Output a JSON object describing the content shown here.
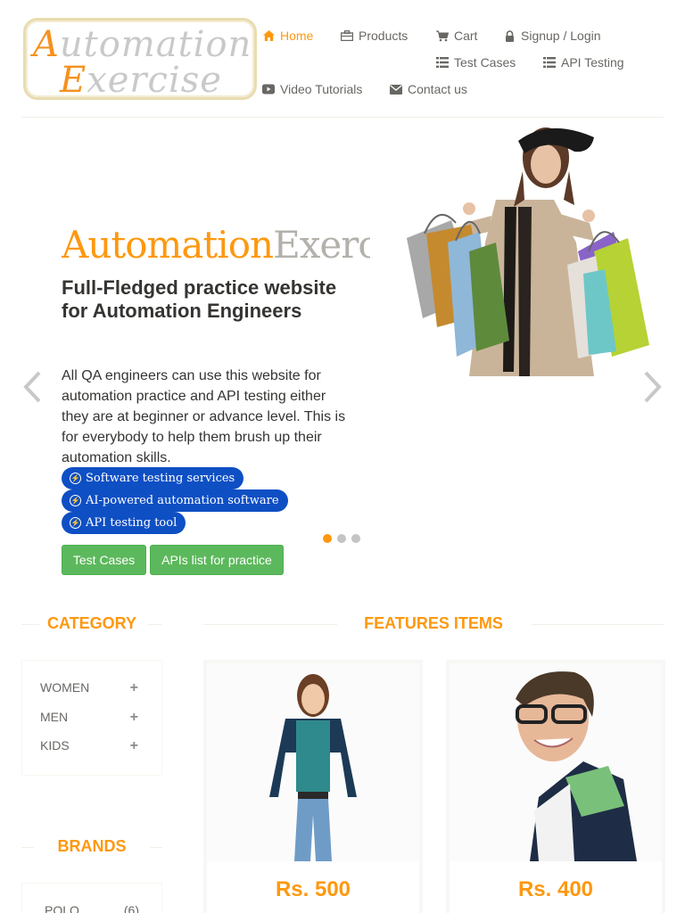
{
  "logo": {
    "line1_cap": "A",
    "line1_rest": "utomation",
    "line2_cap": "E",
    "line2_rest": "xercise"
  },
  "nav": {
    "home": "Home",
    "products": "Products",
    "cart": "Cart",
    "login": "Signup / Login",
    "test_cases": "Test Cases",
    "api_testing": "API Testing",
    "video_tutorials": "Video Tutorials",
    "contact": "Contact us"
  },
  "slider": {
    "title_a": "Automation",
    "title_b": "Exercise",
    "subtitle": "Full-Fledged practice website for Automation Engineers",
    "text": "All QA engineers can use this website for automation practice and API testing either they are at beginner or advance level. This is for everybody to help them brush up their automation skills.",
    "pills": [
      "Software testing services",
      "AI-powered automation software",
      "API testing tool"
    ],
    "btn_test_cases": "Test Cases",
    "btn_apis": "APIs list for practice",
    "active_slide": 1,
    "slide_count": 3
  },
  "sidebar": {
    "category_title": "CATEGORY",
    "categories": [
      {
        "label": "WOMEN"
      },
      {
        "label": "MEN"
      },
      {
        "label": "KIDS"
      }
    ],
    "brands_title": "BRANDS",
    "brands": [
      {
        "label": "POLO",
        "count": "(6)"
      }
    ]
  },
  "features": {
    "title": "FEATURES ITEMS",
    "products": [
      {
        "price": "Rs. 500"
      },
      {
        "price": "Rs. 400"
      }
    ]
  },
  "colors": {
    "accent": "#FE980F",
    "green": "#5CB85C",
    "pill_blue": "#0E4FC4"
  }
}
